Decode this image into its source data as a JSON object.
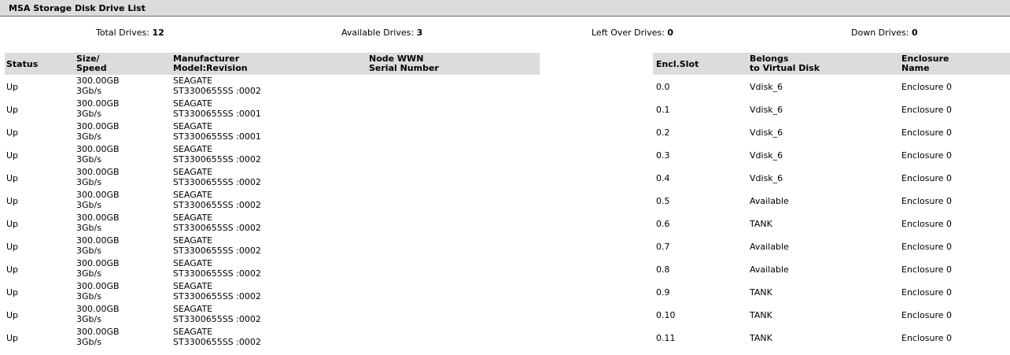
{
  "title": "MSA Storage Disk Drive List",
  "summary": {
    "total_label": "Total Drives:",
    "total_value": "12",
    "available_label": "Available Drives:",
    "available_value": "3",
    "leftover_label": "Left Over Drives:",
    "leftover_value": "0",
    "down_label": "Down Drives:",
    "down_value": "0"
  },
  "columns": {
    "status": "Status",
    "size_1": "Size/",
    "size_2": "Speed",
    "mfr_1": "Manufacturer",
    "mfr_2": "Model:Revision",
    "wwn_1": "Node WWN",
    "wwn_2": "Serial Number",
    "slot": "Encl.Slot",
    "vdisk_1": "Belongs",
    "vdisk_2": "to Virtual Disk",
    "encl_1": "Enclosure",
    "encl_2": "Name"
  },
  "drives": [
    {
      "status": "Up",
      "size": "300.00GB",
      "speed": "3Gb/s",
      "mfr": "SEAGATE",
      "model": "ST3300655SS :0002",
      "slot": "0.0",
      "vdisk": "Vdisk_6",
      "enclosure": "Enclosure 0"
    },
    {
      "status": "Up",
      "size": "300.00GB",
      "speed": "3Gb/s",
      "mfr": "SEAGATE",
      "model": "ST3300655SS :0001",
      "slot": "0.1",
      "vdisk": "Vdisk_6",
      "enclosure": "Enclosure 0"
    },
    {
      "status": "Up",
      "size": "300.00GB",
      "speed": "3Gb/s",
      "mfr": "SEAGATE",
      "model": "ST3300655SS :0001",
      "slot": "0.2",
      "vdisk": "Vdisk_6",
      "enclosure": "Enclosure 0"
    },
    {
      "status": "Up",
      "size": "300.00GB",
      "speed": "3Gb/s",
      "mfr": "SEAGATE",
      "model": "ST3300655SS :0002",
      "slot": "0.3",
      "vdisk": "Vdisk_6",
      "enclosure": "Enclosure 0"
    },
    {
      "status": "Up",
      "size": "300.00GB",
      "speed": "3Gb/s",
      "mfr": "SEAGATE",
      "model": "ST3300655SS :0002",
      "slot": "0.4",
      "vdisk": "Vdisk_6",
      "enclosure": "Enclosure 0"
    },
    {
      "status": "Up",
      "size": "300.00GB",
      "speed": "3Gb/s",
      "mfr": "SEAGATE",
      "model": "ST3300655SS :0002",
      "slot": "0.5",
      "vdisk": "Available",
      "enclosure": "Enclosure 0"
    },
    {
      "status": "Up",
      "size": "300.00GB",
      "speed": "3Gb/s",
      "mfr": "SEAGATE",
      "model": "ST3300655SS :0002",
      "slot": "0.6",
      "vdisk": "TANK",
      "enclosure": "Enclosure 0"
    },
    {
      "status": "Up",
      "size": "300.00GB",
      "speed": "3Gb/s",
      "mfr": "SEAGATE",
      "model": "ST3300655SS :0002",
      "slot": "0.7",
      "vdisk": "Available",
      "enclosure": "Enclosure 0"
    },
    {
      "status": "Up",
      "size": "300.00GB",
      "speed": "3Gb/s",
      "mfr": "SEAGATE",
      "model": "ST3300655SS :0002",
      "slot": "0.8",
      "vdisk": "Available",
      "enclosure": "Enclosure 0"
    },
    {
      "status": "Up",
      "size": "300.00GB",
      "speed": "3Gb/s",
      "mfr": "SEAGATE",
      "model": "ST3300655SS :0002",
      "slot": "0.9",
      "vdisk": "TANK",
      "enclosure": "Enclosure 0"
    },
    {
      "status": "Up",
      "size": "300.00GB",
      "speed": "3Gb/s",
      "mfr": "SEAGATE",
      "model": "ST3300655SS :0002",
      "slot": "0.10",
      "vdisk": "TANK",
      "enclosure": "Enclosure 0"
    },
    {
      "status": "Up",
      "size": "300.00GB",
      "speed": "3Gb/s",
      "mfr": "SEAGATE",
      "model": "ST3300655SS :0002",
      "slot": "0.11",
      "vdisk": "TANK",
      "enclosure": "Enclosure 0"
    }
  ]
}
